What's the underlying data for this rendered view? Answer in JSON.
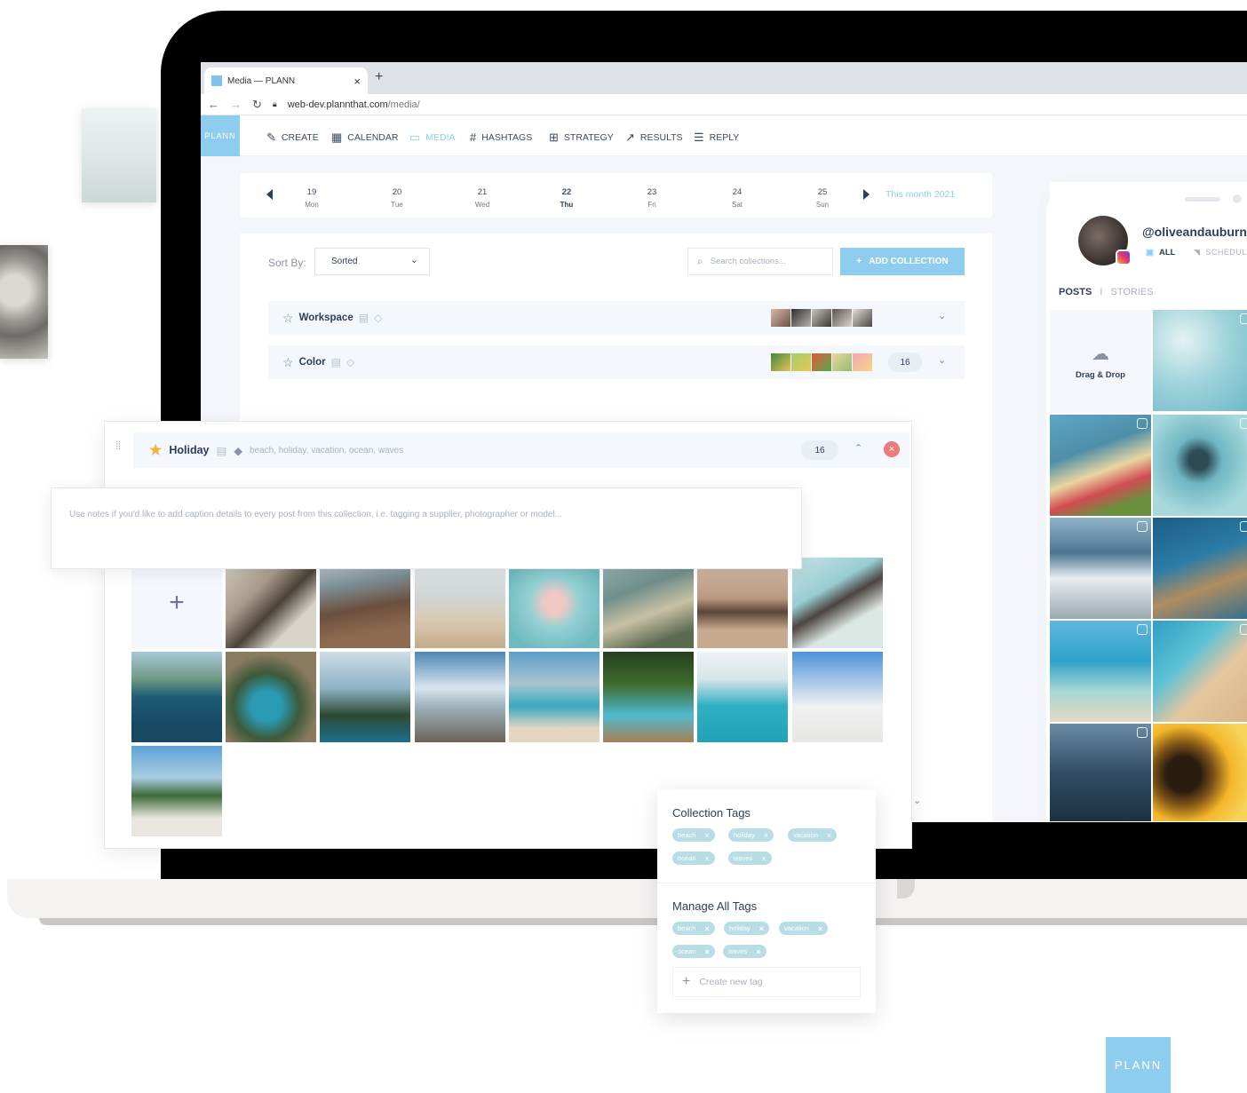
{
  "browser": {
    "tab_title": "Media — PLANN",
    "tab_close": "×",
    "new_tab": "+",
    "url_host": "web-dev.plannthat.com",
    "url_path": "/media/"
  },
  "app": {
    "logo_text": "PLANN",
    "nav": [
      {
        "label": "CREATE",
        "icon": "edit-icon"
      },
      {
        "label": "CALENDAR",
        "icon": "calendar-icon"
      },
      {
        "label": "MEDIA",
        "icon": "folder-icon",
        "active": true
      },
      {
        "label": "HASHTAGS",
        "icon": "hash-icon"
      },
      {
        "label": "STRATEGY",
        "icon": "grid-icon"
      },
      {
        "label": "RESULTS",
        "icon": "trend-icon"
      },
      {
        "label": "REPLY",
        "icon": "chat-icon"
      }
    ],
    "accent_color": "#8fcdef"
  },
  "calendar": {
    "days": [
      {
        "num": "19",
        "dow": "Mon"
      },
      {
        "num": "20",
        "dow": "Tue"
      },
      {
        "num": "21",
        "dow": "Wed"
      },
      {
        "num": "22",
        "dow": "Thu",
        "today": true
      },
      {
        "num": "23",
        "dow": "Fri"
      },
      {
        "num": "24",
        "dow": "Sat"
      },
      {
        "num": "25",
        "dow": "Sun"
      }
    ],
    "month_label": "This month 2021"
  },
  "collections": {
    "sort_label": "Sort By:",
    "sort_value": "Sorted",
    "search_placeholder": "Search collections...",
    "add_button": "ADD COLLECTION",
    "add_plus": "+",
    "rows": [
      {
        "name": "Workspace",
        "count": ""
      },
      {
        "name": "Color",
        "count": "16"
      }
    ]
  },
  "holiday": {
    "name": "Holiday",
    "tags": "beach, holiday, vacation, ocean, waves",
    "count": "16",
    "notes_placeholder": "Use notes if you'd like to add caption details to every post from this collection, i.e. tagging a supplier, photographer or model...",
    "add_symbol": "+"
  },
  "tags_popup": {
    "collection_title": "Collection Tags",
    "collection_tags": [
      "beach",
      "holiday",
      "vacation",
      "ocean",
      "waves"
    ],
    "manage_title": "Manage All Tags",
    "manage_tags": [
      "beach",
      "holiday",
      "vacation",
      "ocean",
      "waves"
    ],
    "new_tag_placeholder": "Create new tag"
  },
  "phone": {
    "handle": "@oliveandauburn",
    "filter_all": "ALL",
    "filter_scheduled": "SCHEDULED",
    "tab_posts": "POSTS",
    "tab_sep": "I",
    "tab_stories": "STORIES",
    "drag_drop": "Drag & Drop"
  },
  "badge": {
    "text": "PLANN"
  }
}
